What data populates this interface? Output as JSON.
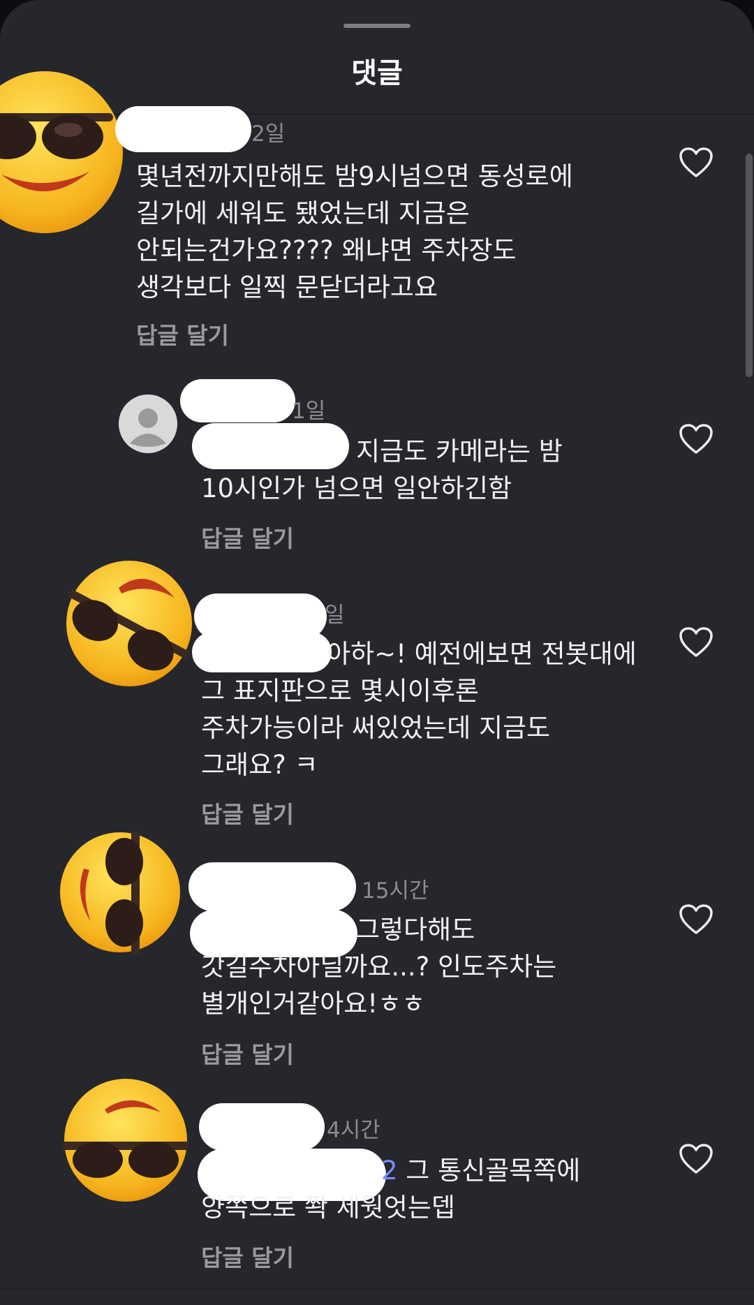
{
  "header": {
    "title": "댓글"
  },
  "comments": [
    {
      "avatar": "sunglasses-emoji",
      "time": "2일",
      "lines": [
        "몇년전까지만해도 밤9시넘으면 동성로에",
        "길가에 세워도 됐었는데 지금은",
        "안되는건가요???? 왜냐면 주차장도",
        "생각보다 일찍 문닫더라고요"
      ],
      "reply": "답글 달기"
    },
    {
      "avatar": "default-user",
      "time": "1일",
      "lines": [
        "지금도 카메라는 밤",
        "10시인가 넘으면 일안하긴함"
      ],
      "reply": "답글 달기"
    },
    {
      "avatar": "sunglasses-emoji",
      "time": "일",
      "lines": [
        "아하~! 예전에보면 전봇대에",
        "그 표지판으로 몇시이후론",
        "주차가능이라 써있었는데 지금도",
        "그래요? ㅋ"
      ],
      "reply": "답글 달기"
    },
    {
      "avatar": "sunglasses-emoji",
      "time": "15시간",
      "lines": [
        "그렇다해도",
        "갓길주차아닐까요...? 인도주차는",
        "별개인거같아요!ㅎㅎ"
      ],
      "reply": "답글 달기"
    },
    {
      "avatar": "sunglasses-emoji",
      "time": "4시간",
      "mention": "2",
      "lines": [
        " 그 통신골목쪽에",
        "양쪽으로 쫙 세웟엇는뎁"
      ],
      "reply": "답글 달기"
    }
  ],
  "icons": {
    "like": "heart-outline-icon"
  },
  "colors": {
    "background": "#26272c",
    "text": "#f2f2f2",
    "meta": "#8b8c91",
    "mention": "#7b8cff"
  }
}
